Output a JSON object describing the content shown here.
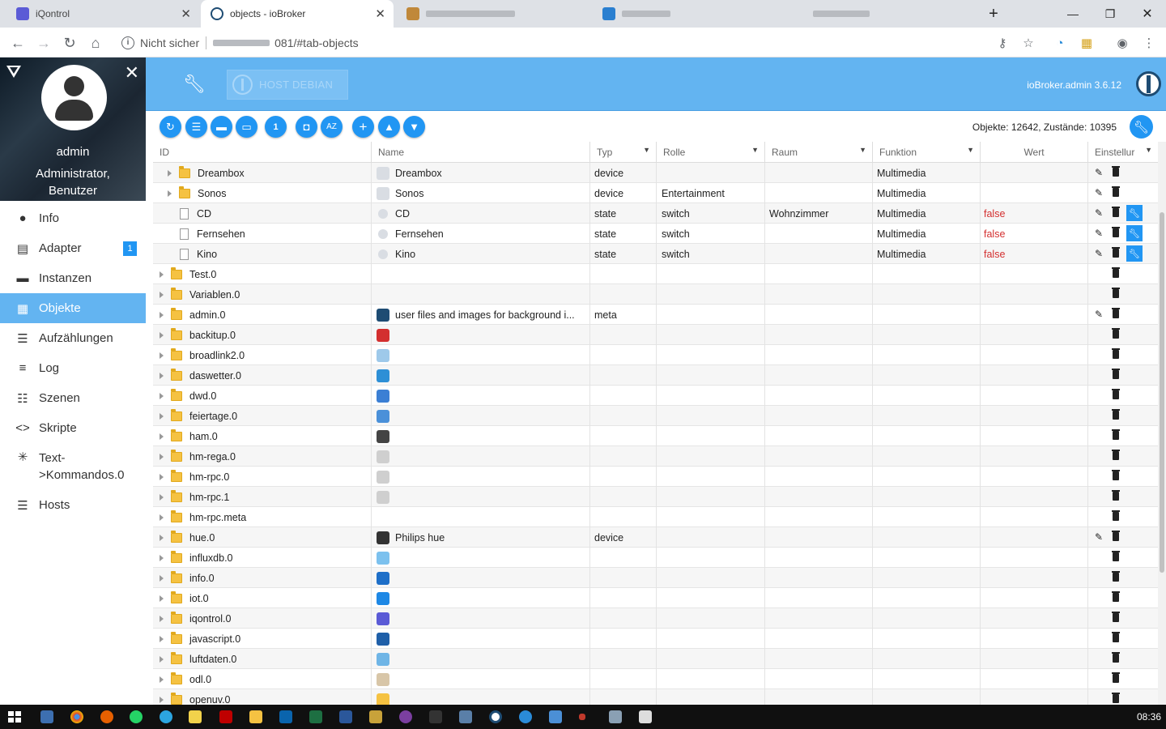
{
  "browser": {
    "tabs": [
      {
        "title": "iQontrol",
        "color": "#5b5bd6"
      },
      {
        "title": "objects - ioBroker",
        "color": "#1e4c73"
      }
    ],
    "address": {
      "security": "Nicht sicher",
      "url": "081/#tab-objects"
    }
  },
  "profile": {
    "name": "admin",
    "role_line1": "Administrator,",
    "role_line2": "Benutzer"
  },
  "nav": [
    {
      "label": "Info",
      "icon": "info-icon",
      "glyph": "●"
    },
    {
      "label": "Adapter",
      "icon": "store-icon",
      "glyph": "▤",
      "badge": "1"
    },
    {
      "label": "Instanzen",
      "icon": "instances-icon",
      "glyph": "▬"
    },
    {
      "label": "Objekte",
      "icon": "objects-icon",
      "glyph": "▦",
      "active": true
    },
    {
      "label": "Aufzählungen",
      "icon": "enums-icon",
      "glyph": "☰"
    },
    {
      "label": "Log",
      "icon": "log-icon",
      "glyph": "≡"
    },
    {
      "label": "Szenen",
      "icon": "scenes-icon",
      "glyph": "☷"
    },
    {
      "label": "Skripte",
      "icon": "code-icon",
      "glyph": "<>"
    },
    {
      "label": "Text->Kommandos.0",
      "label1": "Text-",
      "label2": ">Kommandos.0",
      "icon": "snowflake-icon",
      "glyph": "✳"
    },
    {
      "label": "Hosts",
      "icon": "hosts-icon",
      "glyph": "☰"
    }
  ],
  "header": {
    "host_button": "HOST DEBIAN",
    "version": "ioBroker.admin 3.6.12"
  },
  "toolbar": {
    "stats": "Objekte: 12642, Zustände: 10395"
  },
  "table": {
    "columns": [
      "ID",
      "Name",
      "Typ",
      "Rolle",
      "Raum",
      "Funktion",
      "Wert",
      "Einstellur"
    ],
    "rows": [
      {
        "id": "Dreambox",
        "name": "Dreambox",
        "typ": "device",
        "rolle": "",
        "raum": "",
        "funktion": "Multimedia",
        "wert": "",
        "level": 1,
        "kind": "folder",
        "icon": "device-icon",
        "iconColor": "#d9dde3",
        "edit": true,
        "wrench": false
      },
      {
        "id": "Sonos",
        "name": "Sonos",
        "typ": "device",
        "rolle": "Entertainment",
        "raum": "",
        "funktion": "Multimedia",
        "wert": "",
        "level": 1,
        "kind": "folder",
        "icon": "device-icon",
        "iconColor": "#d9dde3",
        "edit": true,
        "wrench": false
      },
      {
        "id": "CD",
        "name": "CD",
        "typ": "state",
        "rolle": "switch",
        "raum": "Wohnzimmer",
        "funktion": "Multimedia",
        "wert": "false",
        "level": 1,
        "kind": "file",
        "icon": "state-icon",
        "iconColor": "#d9dde3",
        "edit": true,
        "wrench": true
      },
      {
        "id": "Fernsehen",
        "name": "Fernsehen",
        "typ": "state",
        "rolle": "switch",
        "raum": "",
        "funktion": "Multimedia",
        "wert": "false",
        "level": 1,
        "kind": "file",
        "icon": "state-icon",
        "iconColor": "#d9dde3",
        "edit": true,
        "wrench": true
      },
      {
        "id": "Kino",
        "name": "Kino",
        "typ": "state",
        "rolle": "switch",
        "raum": "",
        "funktion": "Multimedia",
        "wert": "false",
        "level": 1,
        "kind": "file",
        "icon": "state-icon",
        "iconColor": "#d9dde3",
        "edit": true,
        "wrench": true
      },
      {
        "id": "Test.0",
        "name": "",
        "typ": "",
        "rolle": "",
        "raum": "",
        "funktion": "",
        "wert": "",
        "level": 0,
        "kind": "folder",
        "icon": "",
        "edit": false,
        "wrench": false
      },
      {
        "id": "Variablen.0",
        "name": "",
        "typ": "",
        "rolle": "",
        "raum": "",
        "funktion": "",
        "wert": "",
        "level": 0,
        "kind": "folder",
        "icon": "",
        "edit": false,
        "wrench": false
      },
      {
        "id": "admin.0",
        "name": "user files and images for background i...",
        "typ": "meta",
        "rolle": "",
        "raum": "",
        "funktion": "",
        "wert": "",
        "level": 0,
        "kind": "folder",
        "icon": "iobroker-icon",
        "iconColor": "#1e4c73",
        "edit": true,
        "wrench": false
      },
      {
        "id": "backitup.0",
        "name": "",
        "typ": "",
        "rolle": "",
        "raum": "",
        "funktion": "",
        "wert": "",
        "level": 0,
        "kind": "folder",
        "icon": "backitup-icon",
        "iconColor": "#d32f2f",
        "edit": false,
        "wrench": false
      },
      {
        "id": "broadlink2.0",
        "name": "",
        "typ": "",
        "rolle": "",
        "raum": "",
        "funktion": "",
        "wert": "",
        "level": 0,
        "kind": "folder",
        "icon": "broadlink-icon",
        "iconColor": "#9ec9ea",
        "edit": false,
        "wrench": false
      },
      {
        "id": "daswetter.0",
        "name": "",
        "typ": "",
        "rolle": "",
        "raum": "",
        "funktion": "",
        "wert": "",
        "level": 0,
        "kind": "folder",
        "icon": "weather-icon",
        "iconColor": "#2d8fd6",
        "edit": false,
        "wrench": false
      },
      {
        "id": "dwd.0",
        "name": "",
        "typ": "",
        "rolle": "",
        "raum": "",
        "funktion": "",
        "wert": "",
        "level": 0,
        "kind": "folder",
        "icon": "dwd-icon",
        "iconColor": "#3b7fd4",
        "edit": false,
        "wrench": false
      },
      {
        "id": "feiertage.0",
        "name": "",
        "typ": "",
        "rolle": "",
        "raum": "",
        "funktion": "",
        "wert": "",
        "level": 0,
        "kind": "folder",
        "icon": "calendar-icon",
        "iconColor": "#4a90d9",
        "edit": false,
        "wrench": false
      },
      {
        "id": "ham.0",
        "name": "",
        "typ": "",
        "rolle": "",
        "raum": "",
        "funktion": "",
        "wert": "",
        "level": 0,
        "kind": "folder",
        "icon": "homekit-icon",
        "iconColor": "#444444",
        "edit": false,
        "wrench": false
      },
      {
        "id": "hm-rega.0",
        "name": "",
        "typ": "",
        "rolle": "",
        "raum": "",
        "funktion": "",
        "wert": "",
        "level": 0,
        "kind": "folder",
        "icon": "homematic-icon",
        "iconColor": "#cfcfcf",
        "edit": false,
        "wrench": false
      },
      {
        "id": "hm-rpc.0",
        "name": "",
        "typ": "",
        "rolle": "",
        "raum": "",
        "funktion": "",
        "wert": "",
        "level": 0,
        "kind": "folder",
        "icon": "homematic-icon",
        "iconColor": "#cfcfcf",
        "edit": false,
        "wrench": false
      },
      {
        "id": "hm-rpc.1",
        "name": "",
        "typ": "",
        "rolle": "",
        "raum": "",
        "funktion": "",
        "wert": "",
        "level": 0,
        "kind": "folder",
        "icon": "homematic-icon",
        "iconColor": "#cfcfcf",
        "edit": false,
        "wrench": false
      },
      {
        "id": "hm-rpc.meta",
        "name": "",
        "typ": "",
        "rolle": "",
        "raum": "",
        "funktion": "",
        "wert": "",
        "level": 0,
        "kind": "folder",
        "icon": "",
        "edit": false,
        "wrench": false
      },
      {
        "id": "hue.0",
        "name": "Philips hue",
        "typ": "device",
        "rolle": "",
        "raum": "",
        "funktion": "",
        "wert": "",
        "level": 0,
        "kind": "folder",
        "icon": "hue-icon",
        "iconColor": "#333333",
        "edit": true,
        "wrench": false
      },
      {
        "id": "influxdb.0",
        "name": "",
        "typ": "",
        "rolle": "",
        "raum": "",
        "funktion": "",
        "wert": "",
        "level": 0,
        "kind": "folder",
        "icon": "influxdb-icon",
        "iconColor": "#7cc1ee",
        "edit": false,
        "wrench": false
      },
      {
        "id": "info.0",
        "name": "",
        "typ": "",
        "rolle": "",
        "raum": "",
        "funktion": "",
        "wert": "",
        "level": 0,
        "kind": "folder",
        "icon": "info-icon",
        "iconColor": "#1e6fc8",
        "edit": false,
        "wrench": false
      },
      {
        "id": "iot.0",
        "name": "",
        "typ": "",
        "rolle": "",
        "raum": "",
        "funktion": "",
        "wert": "",
        "level": 0,
        "kind": "folder",
        "icon": "cloud-icon",
        "iconColor": "#1e88e5",
        "edit": false,
        "wrench": false
      },
      {
        "id": "iqontrol.0",
        "name": "",
        "typ": "",
        "rolle": "",
        "raum": "",
        "funktion": "",
        "wert": "",
        "level": 0,
        "kind": "folder",
        "icon": "iqontrol-icon",
        "iconColor": "#5b5bd6",
        "edit": false,
        "wrench": false
      },
      {
        "id": "javascript.0",
        "name": "",
        "typ": "",
        "rolle": "",
        "raum": "",
        "funktion": "",
        "wert": "",
        "level": 0,
        "kind": "folder",
        "icon": "javascript-icon",
        "iconColor": "#1f5fa8",
        "edit": false,
        "wrench": false
      },
      {
        "id": "luftdaten.0",
        "name": "",
        "typ": "",
        "rolle": "",
        "raum": "",
        "funktion": "",
        "wert": "",
        "level": 0,
        "kind": "folder",
        "icon": "air-icon",
        "iconColor": "#6fb5e6",
        "edit": false,
        "wrench": false
      },
      {
        "id": "odl.0",
        "name": "",
        "typ": "",
        "rolle": "",
        "raum": "",
        "funktion": "",
        "wert": "",
        "level": 0,
        "kind": "folder",
        "icon": "chart-icon",
        "iconColor": "#d8c6a8",
        "edit": false,
        "wrench": false
      },
      {
        "id": "openuv.0",
        "name": "",
        "typ": "",
        "rolle": "",
        "raum": "",
        "funktion": "",
        "wert": "",
        "level": 0,
        "kind": "folder",
        "icon": "sun-icon",
        "iconColor": "#f5c242",
        "edit": false,
        "wrench": false
      }
    ]
  },
  "taskbar": {
    "clock": "08:36"
  }
}
